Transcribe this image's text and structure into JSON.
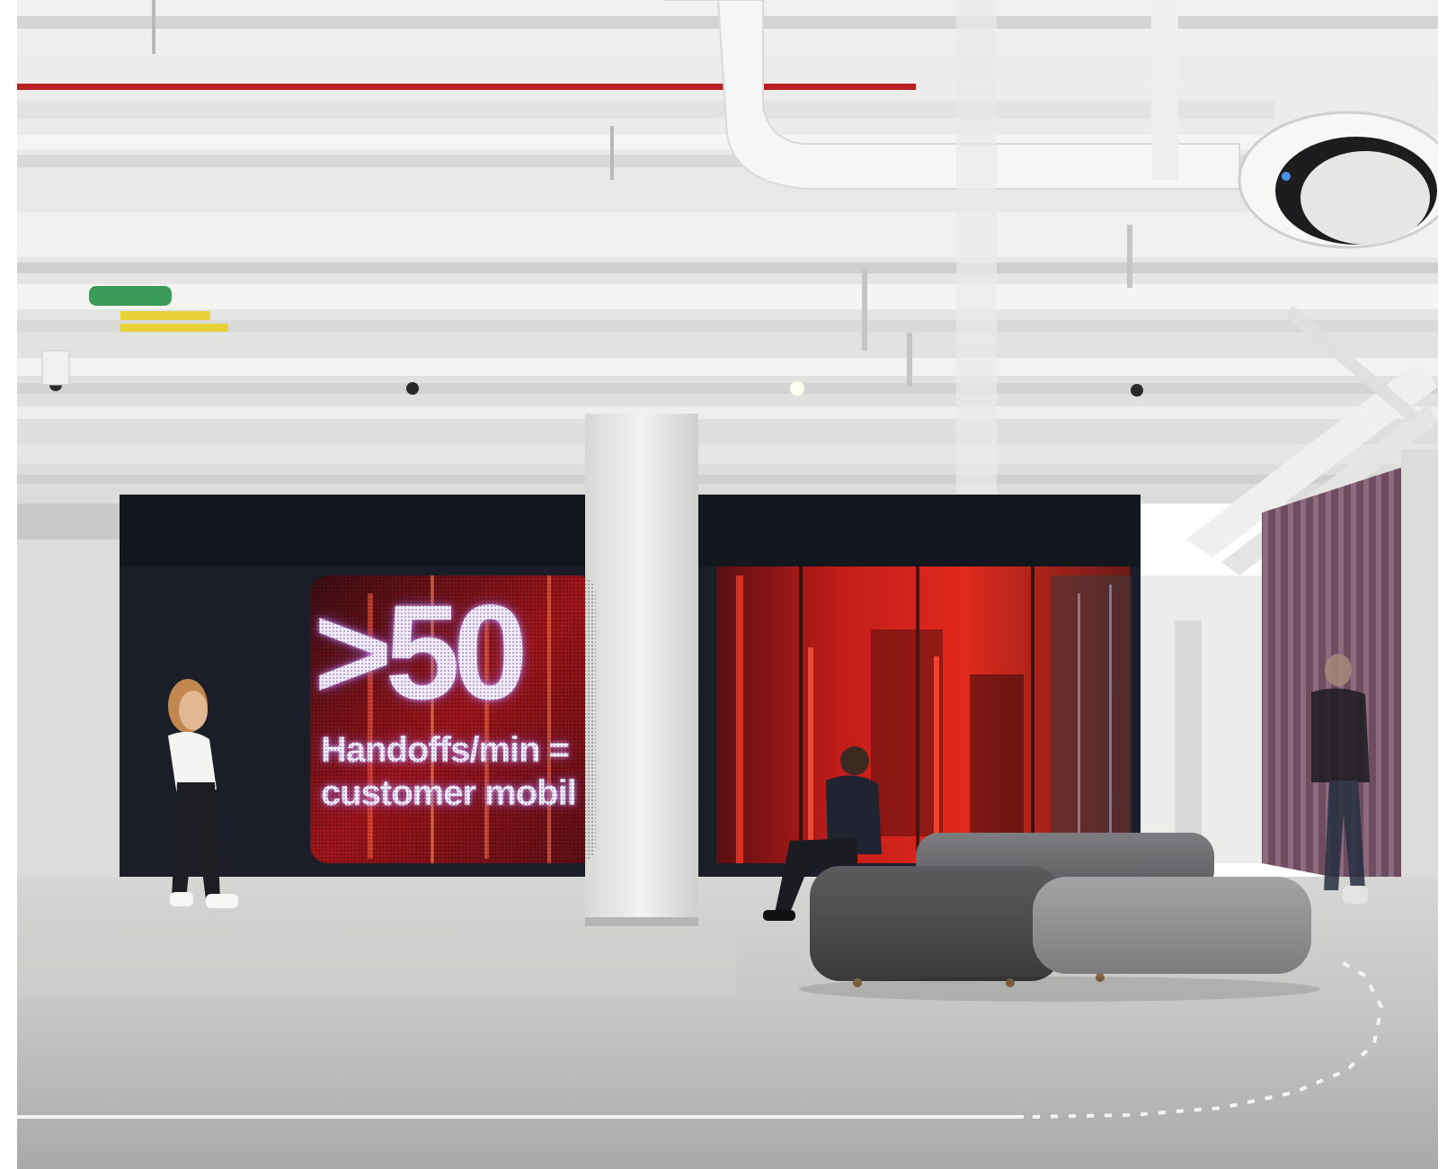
{
  "photo": {
    "scene": "office-lobby",
    "display": {
      "big_text": ">50",
      "line1": "Handoffs/min =",
      "line2": "customer mobil"
    },
    "colors": {
      "ceiling": "#e8e8e6",
      "wall_dark": "#1d1f2b",
      "led_red": "#d8231b",
      "floor": "#c9c9c7",
      "seat_dark": "#4a4a4c",
      "seat_light": "#8e8e90",
      "slat_wall": "#7a5a6e"
    }
  }
}
